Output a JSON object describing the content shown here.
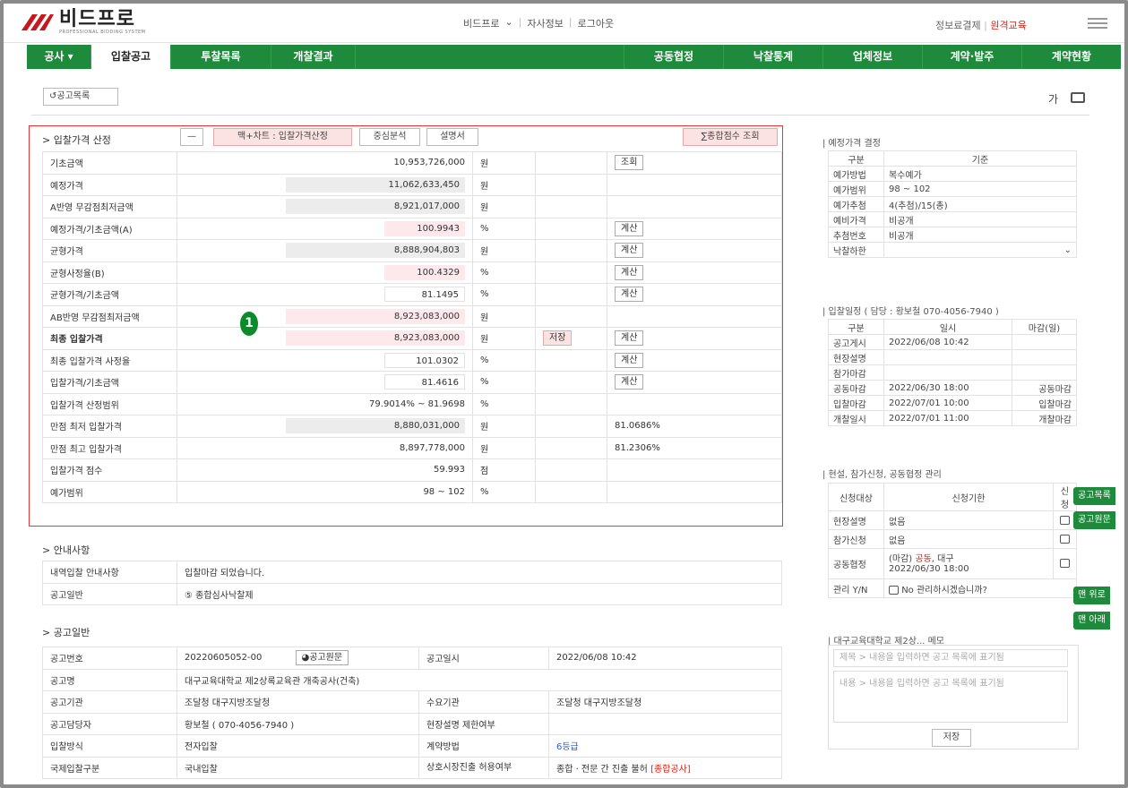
{
  "header": {
    "logo_text": "비드프로",
    "logo_sub": "PROFESSIONAL BIDDING SYSTEM",
    "nav_site": "비드프로",
    "nav_company": "자사정보",
    "nav_logout": "로그아웃",
    "right_pay": "정보료결제",
    "right_edu": "원격교육"
  },
  "nav": {
    "items": [
      "공사 ▾",
      "입찰공고",
      "투찰목록",
      "개찰결과"
    ],
    "right_items": [
      "공동협정",
      "낙찰통계",
      "업체정보",
      "계약·발주",
      "계약현황"
    ]
  },
  "toolbar": {
    "list_label": "공고목록",
    "font_label": "가"
  },
  "price_section": {
    "title": "> 입찰가격 산정",
    "minus": "—",
    "mac_chart": "맥+차트 : 입찰가격산정",
    "analysis": "중심분석",
    "manual": "설명서",
    "total": "∑종합점수 조회",
    "rows": [
      {
        "label": "기초금액",
        "value": "10,953,726,000",
        "unit": "원",
        "btn": "조회"
      },
      {
        "label": "예정가격",
        "value": "11,062,633,450",
        "unit": "원"
      },
      {
        "label": "A반영 무감점최저금액",
        "value": "8,921,017,000",
        "unit": "원"
      },
      {
        "label": "예정가격/기초금액(A)",
        "value": "100.9943",
        "unit": "%",
        "btn": "계산"
      },
      {
        "label": "균형가격",
        "value": "8,888,904,803",
        "unit": "원",
        "btn": "계산"
      },
      {
        "label": "균형사정율(B)",
        "value": "100.4329",
        "unit": "%",
        "btn": "계산"
      },
      {
        "label": "균형가격/기초금액",
        "value": "81.1495",
        "unit": "%",
        "btn": "계산"
      },
      {
        "label": "AB반영 무감점최저금액",
        "value": "8,923,083,000",
        "unit": "원"
      },
      {
        "label": "최종 입찰가격",
        "value": "8,923,083,000",
        "unit": "원",
        "save": "저장",
        "btn": "계산"
      },
      {
        "label": "최종 입찰가격 사정율",
        "value": "101.0302",
        "unit": "%",
        "btn": "계산"
      },
      {
        "label": "입찰가격/기초금액",
        "value": "81.4616",
        "unit": "%",
        "btn": "계산"
      },
      {
        "label": "입찰가격 산정범위",
        "value": "79.9014% ~ 81.9698",
        "unit": "%"
      },
      {
        "label": "만점 최저 입찰가격",
        "value": "8,880,031,000",
        "unit": "원",
        "extra": "81.0686%"
      },
      {
        "label": "만점 최고 입찰가격",
        "value": "8,897,778,000",
        "unit": "원",
        "extra": "81.2306%"
      },
      {
        "label": "입찰가격 점수",
        "value": "59.993",
        "unit": "점"
      },
      {
        "label": "예가범위",
        "value": "98 ~ 102",
        "unit": "%"
      }
    ],
    "marker": "1"
  },
  "notice": {
    "title": "> 안내사항",
    "rows": [
      {
        "label": "내역입찰 안내사항",
        "value": "입찰마감 되었습니다."
      },
      {
        "label": "공고일반",
        "value": "⑤ 종합심사낙찰제"
      }
    ]
  },
  "general": {
    "title": "> 공고일반",
    "no_label": "공고번호",
    "no_value": "20220605052-00",
    "orig_btn": "공고원문",
    "date_label": "공고일시",
    "date_value": "2022/06/08 10:42",
    "name_label": "공고명",
    "name_value": "대구교육대학교 제2상록교육관 개축공사(건축)",
    "org_label": "공고기관",
    "org_value": "조달청 대구지방조달청",
    "demand_label": "수요기관",
    "demand_value": "조달청 대구지방조달청",
    "mgr_label": "공고담당자",
    "mgr_value": "황보철 ( 070-4056-7940 )",
    "site_label": "현장설명 제한여부",
    "site_value": "",
    "method_label": "입찰방식",
    "method_value": "전자입찰",
    "contract_label": "계약방법",
    "contract_value": "6등급",
    "intl_label": "국제입찰구분",
    "intl_value": "국내입찰",
    "mutual_label": "상호시장진출 허용여부",
    "mutual_value": "종합 · 전문 간 진출 불허",
    "mutual_tag": "[종합공사]"
  },
  "estimate": {
    "title": "| 예정가격 결정",
    "h1": "구분",
    "h2": "기준",
    "rows": [
      [
        "예가방법",
        "복수예가"
      ],
      [
        "예가범위",
        "98 ~ 102"
      ],
      [
        "예가추첨",
        "4(추첨)/15(총)"
      ],
      [
        "예비가격",
        "비공개"
      ],
      [
        "추첨번호",
        "비공개"
      ],
      [
        "낙찰하한",
        ""
      ]
    ]
  },
  "schedule": {
    "title": "| 입찰일정 ( 담당 : 황보철 070-4056-7940 )",
    "h1": "구분",
    "h2": "일시",
    "h3": "마감(일)",
    "rows": [
      [
        "공고게시",
        "2022/06/08 10:42",
        ""
      ],
      [
        "현장설명",
        "",
        ""
      ],
      [
        "참가마감",
        "",
        ""
      ],
      [
        "공동마감",
        "2022/06/30 18:00",
        "공동마감"
      ],
      [
        "입찰마감",
        "2022/07/01 10:00",
        "입찰마감"
      ],
      [
        "개찰일시",
        "2022/07/01 11:00",
        "개찰마감"
      ]
    ]
  },
  "apply": {
    "title": "| 현설, 참가신청, 공동협정 관리",
    "h1": "신청대상",
    "h2": "신청기한",
    "h3": "신청",
    "rows": [
      [
        "현장설명",
        "없음"
      ],
      [
        "참가신청",
        "없음"
      ]
    ],
    "joint_label": "공동협정",
    "joint_pre": "(마감) ",
    "joint_red": "공동",
    "joint_post": ", 대구",
    "joint_date": "2022/06/30 18:00",
    "manage_label": "관리 Y/N",
    "manage_text": "No 관리하시겠습니까?"
  },
  "memo": {
    "title": "| 대구교육대학교 제2상... 메모",
    "subject_ph": "제목 > 내용을 입력하면 공고 목록에 표기됨",
    "content_ph": "내용 > 내용을 입력하면 공고 목록에 표기됨",
    "save": "저장"
  },
  "side": {
    "list": "공고목록",
    "orig": "공고원문",
    "top": "맨 위로",
    "bottom": "맨 아래"
  }
}
